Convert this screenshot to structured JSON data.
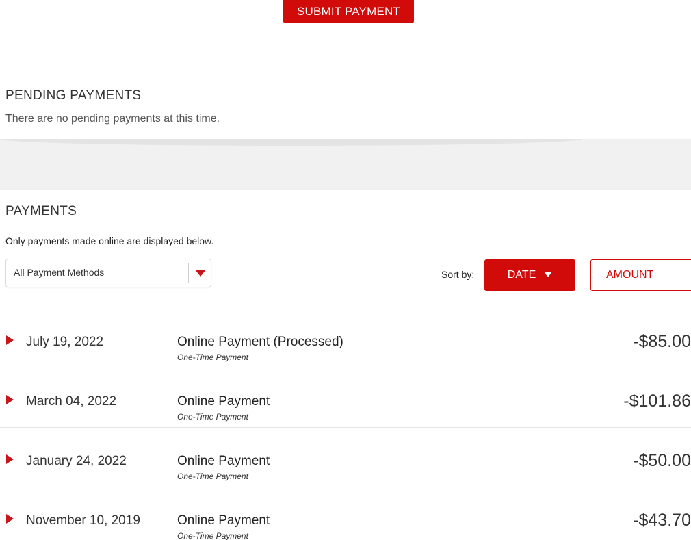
{
  "header": {
    "submit_label": "SUBMIT PAYMENT"
  },
  "pending": {
    "title": "PENDING PAYMENTS",
    "message": "There are no pending payments at this time."
  },
  "payments": {
    "title": "PAYMENTS",
    "note": "Only payments made online are displayed below.",
    "filter": {
      "selected": "All Payment Methods",
      "icon": "chevron-down-icon"
    },
    "sort": {
      "label": "Sort by:",
      "date_label": "DATE",
      "amount_label": "AMOUNT",
      "active": "DATE"
    },
    "rows": [
      {
        "date": "July 19, 2022",
        "description": "Online Payment (Processed)",
        "type": "One-Time Payment",
        "amount": "-$85.00"
      },
      {
        "date": "March 04, 2022",
        "description": "Online Payment",
        "type": "One-Time Payment",
        "amount": "-$101.86"
      },
      {
        "date": "January 24, 2022",
        "description": "Online Payment",
        "type": "One-Time Payment",
        "amount": "-$50.00"
      },
      {
        "date": "November 10, 2019",
        "description": "Online Payment",
        "type": "One-Time Payment",
        "amount": "-$43.70"
      }
    ]
  },
  "colors": {
    "accent": "#d10a0a",
    "arrow": "#c8161d",
    "band": "#f1f1f1"
  }
}
